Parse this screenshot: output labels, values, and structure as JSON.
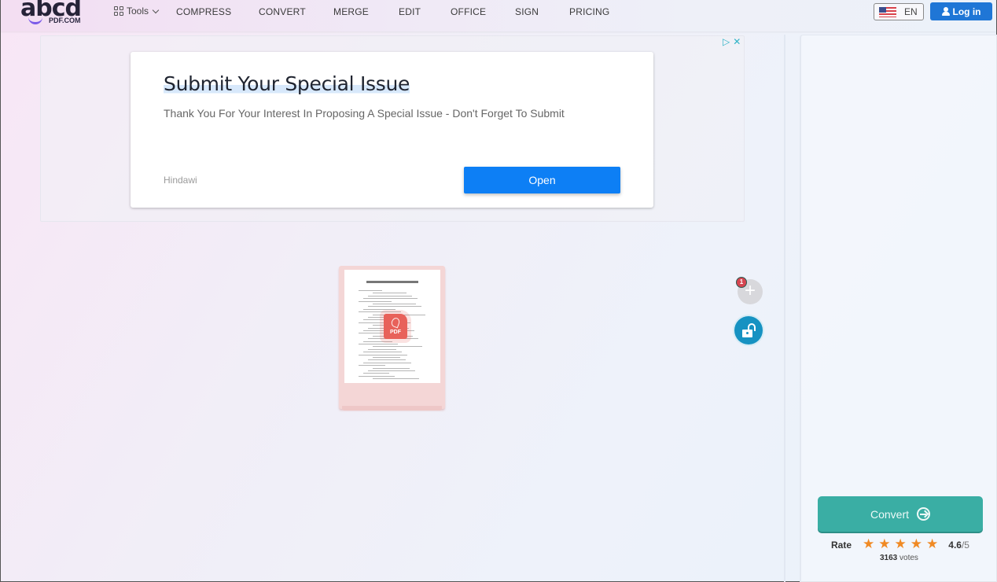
{
  "header": {
    "logo_main": "abcd",
    "logo_sub": "PDF.COM",
    "tools_label": "Tools",
    "nav": [
      "COMPRESS",
      "CONVERT",
      "MERGE",
      "EDIT",
      "OFFICE",
      "SIGN",
      "PRICING"
    ],
    "language": "EN",
    "login_label": "Log in"
  },
  "ad": {
    "title": "Submit Your Special Issue",
    "description": "Thank You For Your Interest In Proposing A Special Issue - Don't Forget To Submit",
    "advertiser": "Hindawi",
    "cta_label": "Open",
    "adchoices_icon": "▷",
    "close_icon": "✕"
  },
  "workspace": {
    "file_thumbnail_header": "PKcdPDF: https://abcdpdf.com",
    "file_type_badge": "PDF",
    "file_count": "1",
    "add_icon": "+"
  },
  "sidebar": {
    "convert_label": "Convert",
    "rate_label": "Rate",
    "rating_value": "4.6",
    "rating_max": "/5",
    "stars": 5,
    "votes_count": "3163",
    "votes_label": "votes"
  },
  "colors": {
    "login_blue": "#1f76d6",
    "ad_cta_blue": "#0d7ff5",
    "convert_teal": "#3aaea4",
    "lock_blue": "#1692c2",
    "star_orange": "#f08a24",
    "badge_red": "#d64550",
    "pdf_red": "#e8615a"
  }
}
